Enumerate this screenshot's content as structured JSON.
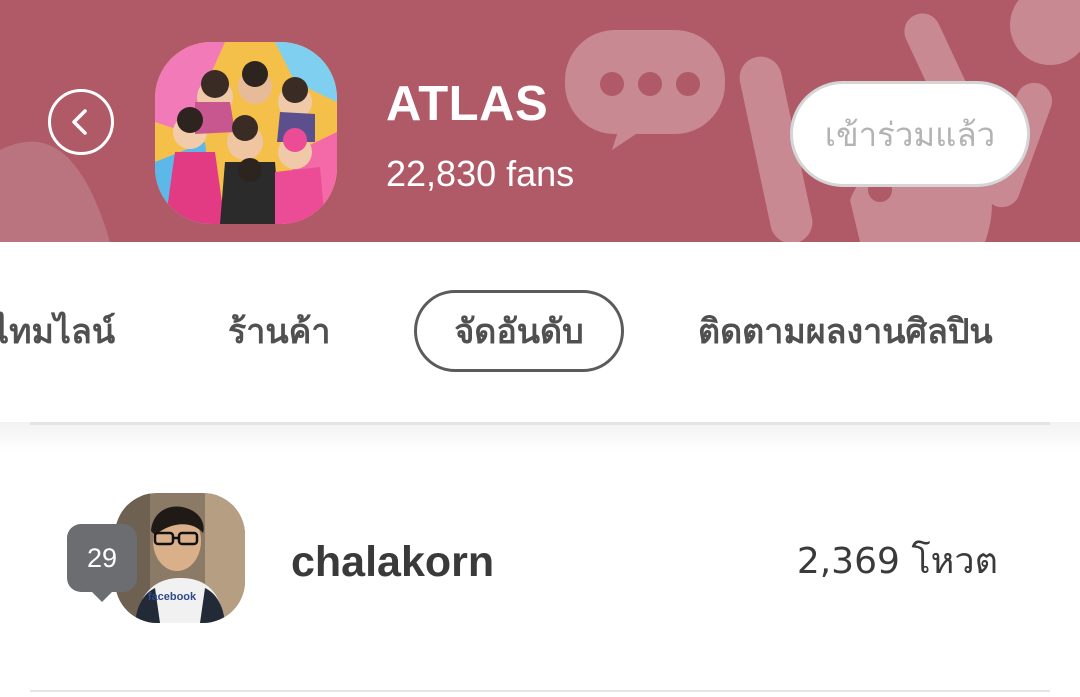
{
  "header": {
    "group_name": "ATLAS",
    "fan_count": "22,830",
    "fan_unit": "fans",
    "join_button_label": "เข้าร่วมแล้ว",
    "back_icon": "chevron-left-icon",
    "background_color": "#b05a68"
  },
  "tabs": [
    {
      "label": "ไทมไลน์",
      "active": false
    },
    {
      "label": "ร้านค้า",
      "active": false
    },
    {
      "label": "จัดอันดับ",
      "active": true
    },
    {
      "label": "ติดตามผลงานศิลปิน",
      "active": false
    }
  ],
  "ranking": [
    {
      "rank": "29",
      "username": "chalakorn",
      "votes": "2,369",
      "vote_unit": "โหวต"
    }
  ]
}
